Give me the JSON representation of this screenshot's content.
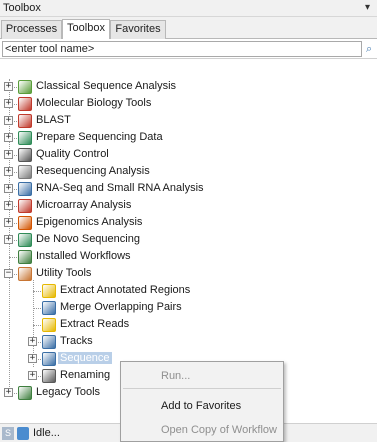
{
  "panel": {
    "title": "Toolbox"
  },
  "tabs": [
    {
      "label": "Processes",
      "active": false
    },
    {
      "label": "Toolbox",
      "active": true
    },
    {
      "label": "Favorites",
      "active": false
    }
  ],
  "search": {
    "placeholder": "<enter tool name>"
  },
  "tree": [
    {
      "label": "Classical Sequence Analysis",
      "icon": "classical-sequence-icon",
      "color": "#5a9e3a",
      "expander": "+"
    },
    {
      "label": "Molecular Biology Tools",
      "icon": "molecular-biology-icon",
      "color": "#c0392b",
      "expander": "+"
    },
    {
      "label": "BLAST",
      "icon": "blast-icon",
      "color": "#c0392b",
      "expander": "+"
    },
    {
      "label": "Prepare Sequencing Data",
      "icon": "prepare-data-icon",
      "color": "#2e8b57",
      "expander": "+"
    },
    {
      "label": "Quality Control",
      "icon": "quality-control-icon",
      "color": "#555555",
      "expander": "+"
    },
    {
      "label": "Resequencing Analysis",
      "icon": "resequencing-icon",
      "color": "#7a7a7a",
      "expander": "+"
    },
    {
      "label": "RNA-Seq and Small RNA Analysis",
      "icon": "rna-seq-icon",
      "color": "#3a6ea5",
      "expander": "+"
    },
    {
      "label": "Microarray Analysis",
      "icon": "microarray-icon",
      "color": "#c0392b",
      "expander": "+"
    },
    {
      "label": "Epigenomics Analysis",
      "icon": "epigenomics-icon",
      "color": "#d35400",
      "expander": "+"
    },
    {
      "label": "De Novo Sequencing",
      "icon": "de-novo-icon",
      "color": "#2e8b57",
      "expander": "+"
    },
    {
      "label": "Installed Workflows",
      "icon": "workflows-icon",
      "color": "#3f7f3f",
      "expander": ""
    },
    {
      "label": "Utility Tools",
      "icon": "utility-tools-icon",
      "color": "#c87533",
      "expander": "-"
    },
    {
      "label": "Extract Annotated Regions",
      "icon": "extract-regions-icon",
      "color": "#e6b800",
      "expander": ""
    },
    {
      "label": "Merge Overlapping Pairs",
      "icon": "merge-pairs-icon",
      "color": "#3a6ea5",
      "expander": ""
    },
    {
      "label": "Extract Reads",
      "icon": "extract-reads-icon",
      "color": "#e6b800",
      "expander": ""
    },
    {
      "label": "Tracks",
      "icon": "tracks-icon",
      "color": "#3a6ea5",
      "expander": "+"
    },
    {
      "label": "Sequence",
      "icon": "sequence-icon",
      "color": "#3a6ea5",
      "expander": "+"
    },
    {
      "label": "Renaming",
      "icon": "renaming-icon",
      "color": "#5a5a5a",
      "expander": "+"
    },
    {
      "label": "Legacy Tools",
      "icon": "legacy-tools-icon",
      "color": "#3f7f3f",
      "expander": "+"
    }
  ],
  "context_menu": {
    "items": [
      {
        "label": "Run...",
        "enabled": false
      },
      {
        "label": "Add to Favorites",
        "enabled": true
      },
      {
        "label": "Open Copy of Workflow",
        "enabled": false
      }
    ]
  },
  "status": {
    "badge": "S",
    "text": "Idle..."
  }
}
